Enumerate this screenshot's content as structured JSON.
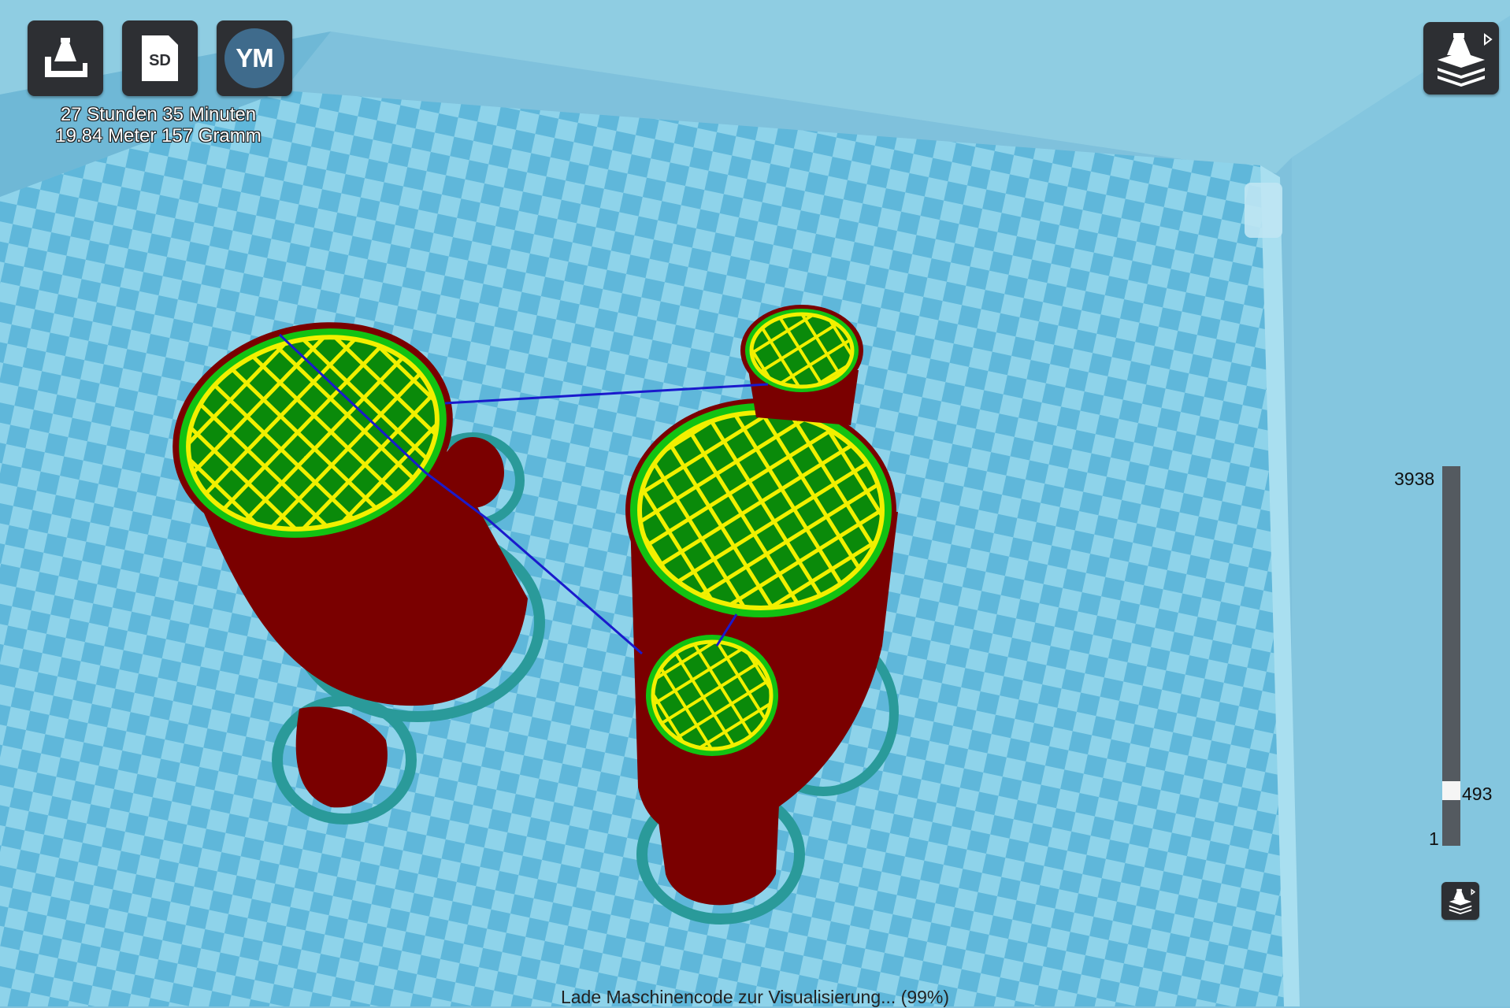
{
  "toolbar": {
    "load_icon": "printer-load-icon",
    "sd_label": "SD",
    "ym_label": "YM",
    "view_icon": "printer-layers-icon"
  },
  "print_info": {
    "time": "27 Stunden 35 Minuten",
    "material": "19.84 Meter 157 Gramm"
  },
  "layer_slider": {
    "max": "3938",
    "current": "493",
    "min": "1",
    "position_fraction": 0.125
  },
  "status": {
    "text": "Lade Maschinencode zur Visualisierung... (99%)"
  },
  "colors": {
    "build_plate_light": "#8ed3ea",
    "build_plate_dark": "#5fb7da",
    "wall": "#7a0000",
    "skin": "#0a8a0a",
    "infill": "#f2f000",
    "travel": "#1a1acc",
    "skirt": "#2a9a9a",
    "ui_dark": "#2d2f33"
  }
}
